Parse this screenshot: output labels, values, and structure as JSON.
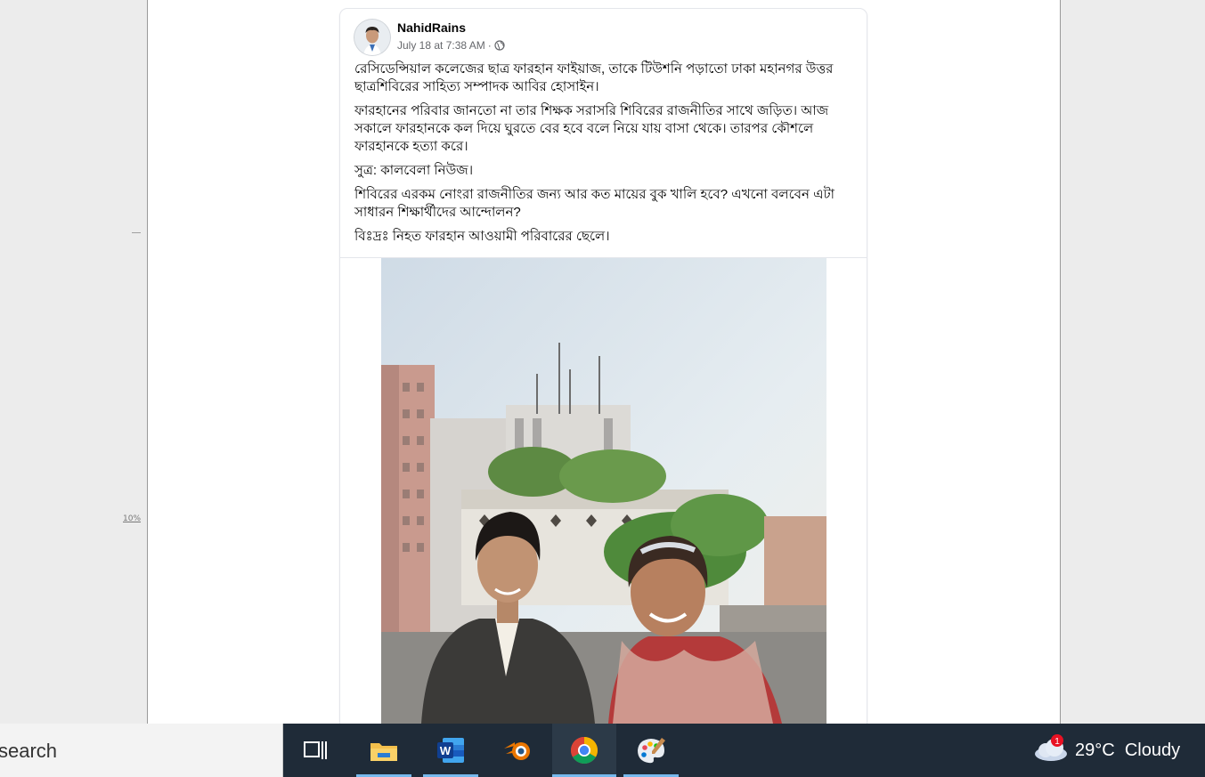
{
  "post": {
    "author": "NahidRains",
    "timestamp": "July 18 at 7:38 AM",
    "separator": "·",
    "privacy_icon": "globe-icon",
    "paragraphs": [
      "রেসিডেন্সিয়াল কলেজের ছাত্র ফারহান ফাইয়াজ, তাকে টিউশনি পড়াতো ঢাকা মহানগর উত্তর ছাত্রশিবিরের সাহিত্য সম্পাদক আবির হোসাইন।",
      "ফারহানের পরিবার জানতো না তার শিক্ষক সরাসরি শিবিরের রাজনীতির সাথে জড়িত। আজ সকালে ফারহানকে কল দিয়ে ঘুরতে বের হবে বলে নিয়ে যায় বাসা থেকে। তারপর কৌশলে ফারহানকে হত্যা করে।",
      "সুত্র: কালবেলা নিউজ।",
      "শিবিরের এরকম নোংরা রাজনীতির জন্য আর কত মায়ের বুক খালি হবে? এখনো বলবেন এটা সাধারন শিক্ষার্থীদের আন্দোলন?",
      "বিঃদ্রঃ নিহত ফারহান আওয়ামী পরিবারের ছেলে।"
    ]
  },
  "document": {
    "ruler_label": "10%"
  },
  "taskbar": {
    "search_text": "search",
    "apps": [
      {
        "name": "task-view-icon"
      },
      {
        "name": "file-explorer-icon"
      },
      {
        "name": "word-icon",
        "letter": "W"
      },
      {
        "name": "blender-icon"
      },
      {
        "name": "chrome-icon",
        "active": true
      },
      {
        "name": "paint-icon"
      }
    ],
    "weather": {
      "icon": "cloudy-weather-icon",
      "badge": "1",
      "temperature": "29°C",
      "condition": "Cloudy"
    }
  },
  "colors": {
    "taskbar": "#1f2b38",
    "accent": "#76b9ed",
    "text_secondary": "#65676b"
  }
}
